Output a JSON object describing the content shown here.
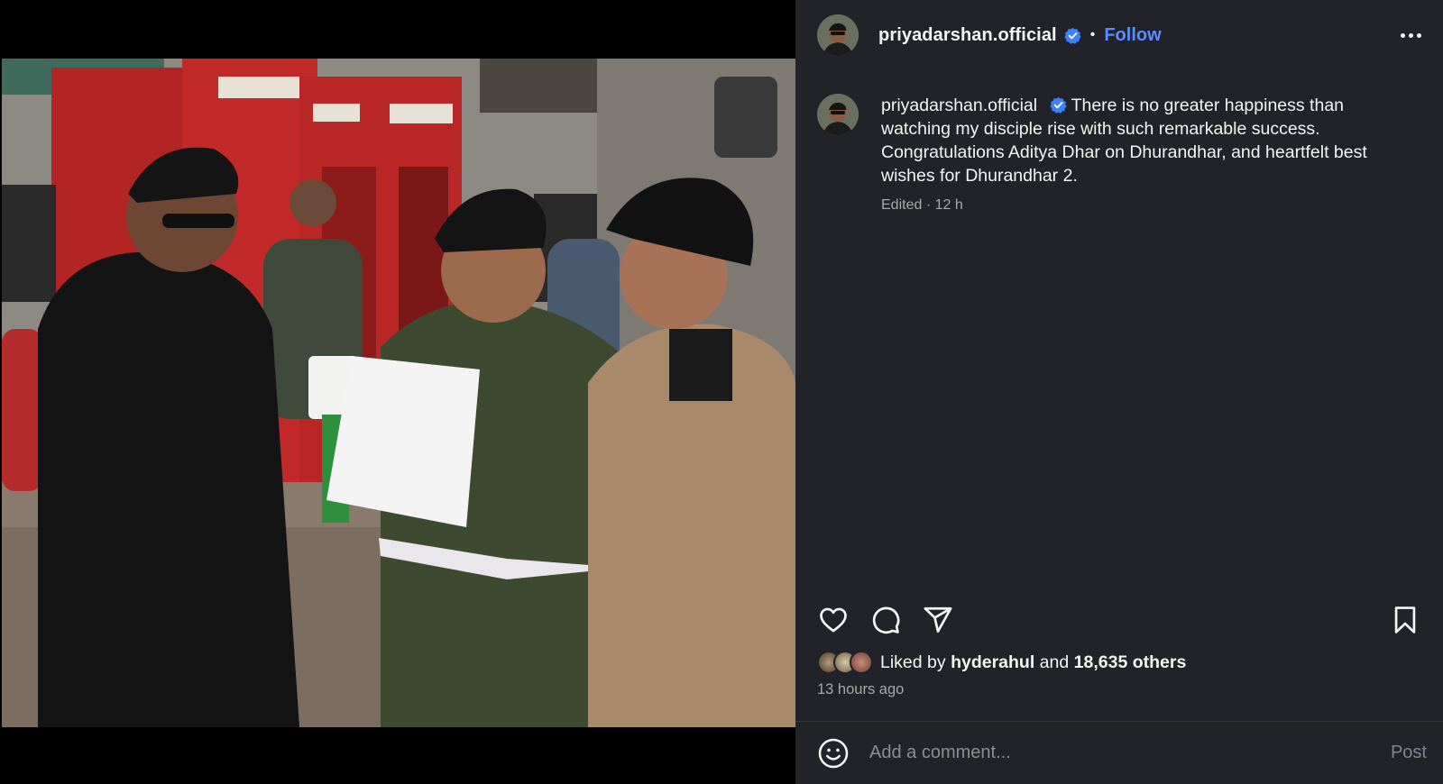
{
  "post": {
    "username": "priyadarshan.official",
    "verified_icon": "verified-badge-icon",
    "separator": "•",
    "follow_label": "Follow",
    "more_icon": "more-horizontal-icon"
  },
  "caption": {
    "username": "priyadarshan.official",
    "text": " There is no greater happiness than watching my disciple rise with such remarkable success. Congratulations Aditya Dhar on Dhurandhar, and heartfelt best wishes for Dhurandhar 2.",
    "meta": "Edited · 12 h"
  },
  "actions": {
    "like_icon": "heart-icon",
    "comment_icon": "comment-icon",
    "share_icon": "share-icon",
    "save_icon": "bookmark-icon"
  },
  "likes": {
    "prefix": "Liked by",
    "user": "hyderahul",
    "joiner": "and",
    "others": "18,635 others"
  },
  "time_ago": "13 hours ago",
  "comment": {
    "placeholder": "Add a comment...",
    "post_label": "Post",
    "emoji_icon": "emoji-icon"
  },
  "colors": {
    "panel_bg": "#212328",
    "accent": "#5b8cff",
    "muted": "#a8a8a8"
  }
}
